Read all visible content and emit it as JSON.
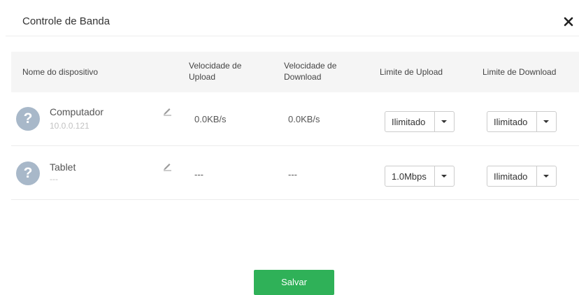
{
  "dialog": {
    "title": "Controle de Banda",
    "close_icon": "close-icon"
  },
  "table": {
    "headers": {
      "device_name": "Nome do dispositivo",
      "upload_speed": "Velocidade de Upload",
      "download_speed": "Velocidade de Download",
      "upload_limit": "Limite de Upload",
      "download_limit": "Limite de Download"
    },
    "rows": [
      {
        "avatar_symbol": "?",
        "name": "Computador",
        "ip": "10.0.0.121",
        "edit_icon": "pencil-icon",
        "upload_speed": "0.0KB/s",
        "download_speed": "0.0KB/s",
        "upload_limit": "Ilimitado",
        "download_limit": "Ilimitado"
      },
      {
        "avatar_symbol": "?",
        "name": "Tablet",
        "ip": "---",
        "edit_icon": "pencil-icon",
        "upload_speed": "---",
        "download_speed": "---",
        "upload_limit": "1.0Mbps",
        "download_limit": "Ilimitado"
      }
    ]
  },
  "footer": {
    "save_label": "Salvar"
  },
  "colors": {
    "save_button": "#2fb158",
    "avatar": "#a8b8c9",
    "header_background": "#f5f5f5"
  }
}
